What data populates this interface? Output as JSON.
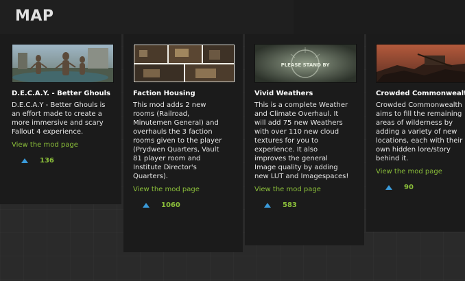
{
  "header": {
    "title": "MAP"
  },
  "mods": [
    {
      "name": "D.E.C.A.Y. - Better Ghouls",
      "description": [
        "D.E.C.A.Y - Better Ghouls is",
        "an effort made to create a",
        "more immersive and scary",
        "Fallout 4 experience."
      ],
      "link_label": "View the mod page",
      "votes": "136",
      "thumb_icon": "ghouls-screenshot"
    },
    {
      "name": "Faction Housing",
      "description": [
        "This mod adds 2 new",
        "rooms (Railroad,",
        "Minutemen General) and",
        "overhauls the 3 faction",
        "rooms given to the player",
        "(Prydwen Quarters, Vault",
        "81 player room and",
        "Institute Director's",
        "Quarters)."
      ],
      "link_label": "View the mod page",
      "votes": "1060",
      "thumb_icon": "rooms-collage-screenshot"
    },
    {
      "name": "Vivid Weathers",
      "description": [
        "This is a complete Weather",
        "and Climate Overhaul. It",
        "will add 75 new Weathers",
        "with over 110 new cloud",
        "textures for you to",
        "experience. It also",
        "improves the general",
        "Image quality by adding",
        "new LUT and Imagespaces!"
      ],
      "link_label": "View the mod page",
      "votes": "583",
      "thumb_icon": "please-stand-by-screenshot",
      "thumb_text": "PLEASE STAND BY"
    },
    {
      "name": "Crowded Commonwealth",
      "description": [
        "Crowded Commonwealth",
        "aims to fill the remaining",
        "areas of wilderness by",
        "adding a variety of new",
        "locations, each with their",
        "own hidden lore/story",
        "behind it."
      ],
      "link_label": "View the mod page",
      "votes": "90",
      "thumb_icon": "wasteland-screenshot"
    }
  ],
  "colors": {
    "link": "#8bbf3a",
    "vote_arrow": "#3a9ad9",
    "card_bg": "#1b1b1b"
  }
}
